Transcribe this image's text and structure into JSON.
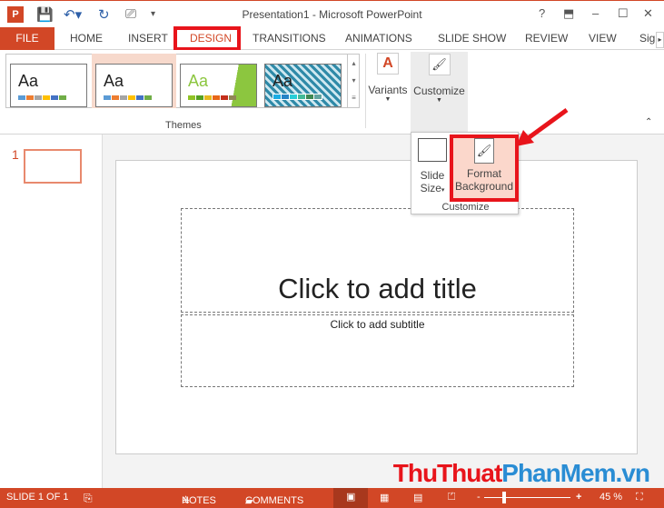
{
  "window": {
    "title": "Presentation1 - Microsoft PowerPoint",
    "help": "?",
    "minimize": "–",
    "maximize": "☐",
    "close": "✕"
  },
  "tabs": [
    "FILE",
    "HOME",
    "INSERT",
    "DESIGN",
    "TRANSITIONS",
    "ANIMATIONS",
    "SLIDE SHOW",
    "REVIEW",
    "VIEW",
    "Sig"
  ],
  "active_tab": "DESIGN",
  "ribbon": {
    "themes_label": "Themes",
    "theme_sample": "Aa",
    "variants": "Variants",
    "customize": "Customize"
  },
  "popup": {
    "slide_size_1": "Slide",
    "slide_size_2": "Size",
    "format_bg_1": "Format",
    "format_bg_2": "Background",
    "group": "Customize"
  },
  "thumbnail": {
    "number": "1"
  },
  "slide": {
    "title": "Click to add title",
    "subtitle": "Click to add subtitle"
  },
  "status": {
    "slide": "SLIDE 1 OF 1",
    "notes": "NOTES",
    "comments": "COMMENTS",
    "zoom": "45 %",
    "minus": "-",
    "plus": "+"
  },
  "watermark": {
    "part1": "ThuThuat",
    "part2": "PhanMem",
    "part3": ".vn"
  },
  "colors": {
    "accent": "#d24726",
    "highlight": "#e8141b"
  }
}
